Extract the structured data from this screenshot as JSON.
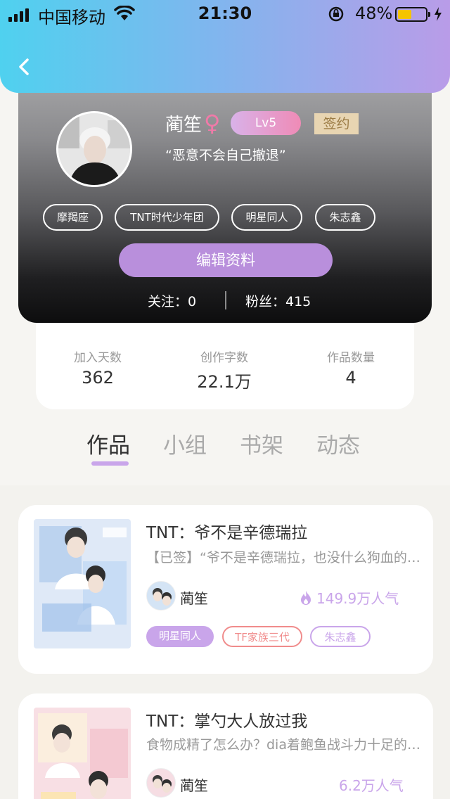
{
  "status_bar": {
    "carrier": "中国移动",
    "time": "21:30",
    "battery_pct": "48%",
    "battery_level": 0.48
  },
  "icons": {
    "back": "chevron-left-icon",
    "gender": "female-icon",
    "hot": "fire-icon"
  },
  "colors": {
    "header_gradient": [
      "#4fd1ef",
      "#7db7ee",
      "#b99ce8"
    ],
    "accent_purple": "#b98fdc",
    "tab_underline": "#c9a5ea",
    "level_badge": [
      "#d9b2e9",
      "#ef8bb6"
    ],
    "signed_badge": "#e8d5b2"
  },
  "profile": {
    "name": "蔺笙",
    "gender_symbol": "♀",
    "level": "Lv5",
    "signed_label": "签约",
    "motto": "“恶意不会自己撤退”",
    "tags": [
      "摩羯座",
      "TNT时代少年团",
      "明星同人",
      "朱志鑫"
    ],
    "edit_button": "编辑资料",
    "follow_label": "关注：0",
    "fans_label": "粉丝：415"
  },
  "stats": [
    {
      "label": "加入天数",
      "value": "362"
    },
    {
      "label": "创作字数",
      "value": "22.1万"
    },
    {
      "label": "作品数量",
      "value": "4"
    }
  ],
  "tabs": [
    {
      "label": "作品",
      "active": true
    },
    {
      "label": "小组",
      "active": false
    },
    {
      "label": "书架",
      "active": false
    },
    {
      "label": "动态",
      "active": false
    }
  ],
  "works": [
    {
      "title": "TNT：爷不是辛德瑞拉",
      "desc": "【已签】“爷不是辛德瑞拉，也没什么狗血的后妈和姐姐”",
      "author": "蔺笙",
      "popularity": "149.9万人气",
      "tags": [
        "明星同人",
        "TF家族三代",
        "朱志鑫"
      ]
    },
    {
      "title": "TNT：掌勺大人放过我",
      "desc": "食物成精了怎么办？dia着鲍鱼战斗力十足的小可爱",
      "author": "蔺笙",
      "popularity": "6.2万人气"
    }
  ]
}
